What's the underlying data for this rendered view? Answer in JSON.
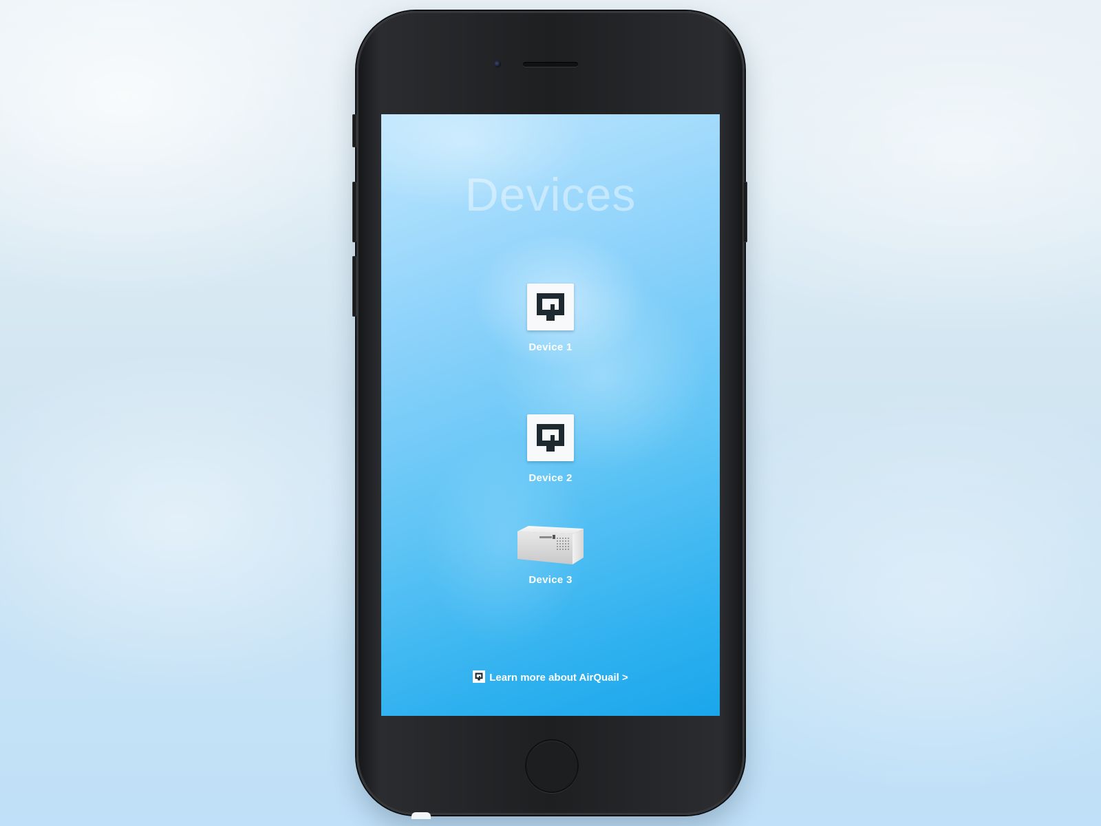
{
  "screen": {
    "title": "Devices"
  },
  "devices": [
    {
      "label": "Device 1",
      "icon": "airquail-logo-icon"
    },
    {
      "label": "Device 2",
      "icon": "airquail-logo-icon"
    },
    {
      "label": "Device 3",
      "icon": "sensor-box-icon"
    }
  ],
  "footer": {
    "link_label": "Learn more about AirQuail >",
    "icon": "airquail-logo-icon"
  },
  "colors": {
    "screen_top": "#bfe6fd",
    "screen_bottom": "#1aa6ec",
    "logo_dark": "#1f2a30",
    "phone_body": "#1e1f21"
  }
}
